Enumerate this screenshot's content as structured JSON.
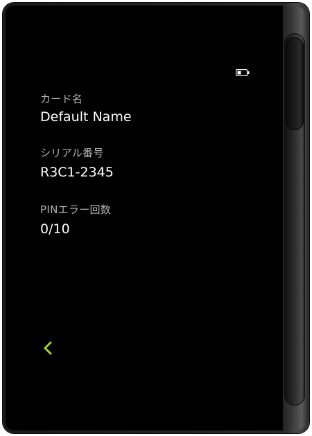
{
  "status": {
    "battery_icon": "battery-low-icon"
  },
  "fields": [
    {
      "label": "カード名",
      "value": "Default Name"
    },
    {
      "label": "シリアル番号",
      "value": "R3C1-2345"
    },
    {
      "label": "PINエラー回数",
      "value": "0/10"
    }
  ],
  "navigation": {
    "back_icon": "chevron-left-icon"
  },
  "colors": {
    "screen_background": "#000000",
    "label_text": "#b4b4b4",
    "value_text": "#ffffff",
    "accent": "#a6d22a"
  }
}
